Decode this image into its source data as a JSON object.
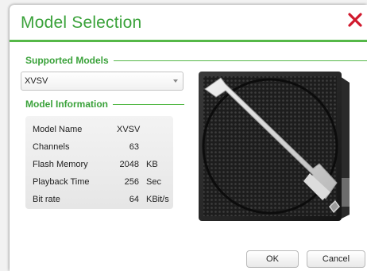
{
  "dialog": {
    "title": "Model Selection",
    "close_icon": "close-x-icon",
    "accent_color": "#3aa23a",
    "close_color": "#d0192d"
  },
  "supported_models": {
    "heading": "Supported Models",
    "selected": "XVSV",
    "options": [
      "XVSV"
    ]
  },
  "model_information": {
    "heading": "Model Information",
    "rows": [
      {
        "label": "Model Name",
        "value": "XVSV",
        "unit": ""
      },
      {
        "label": "Channels",
        "value": "63",
        "unit": ""
      },
      {
        "label": "Flash Memory",
        "value": "2048",
        "unit": "KB"
      },
      {
        "label": "Playback Time",
        "value": "256",
        "unit": "Sec"
      },
      {
        "label": "Bit rate",
        "value": "64",
        "unit": "KBit/s"
      }
    ]
  },
  "preview": {
    "image": "speaker-product-image"
  },
  "buttons": {
    "ok": "OK",
    "cancel": "Cancel"
  }
}
